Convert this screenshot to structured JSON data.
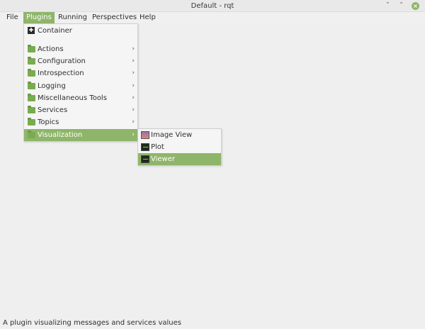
{
  "window": {
    "title": "Default - rqt",
    "minimize_glyph": "˅",
    "maximize_glyph": "˄",
    "close_glyph": "×"
  },
  "menubar": {
    "file": "File",
    "plugins": "Plugins",
    "running": "Running",
    "perspectives": "Perspectives",
    "help": "Help"
  },
  "plugins_menu": {
    "items": [
      {
        "label": "Container",
        "icon": "container-icon"
      },
      {
        "label": "Actions",
        "icon": "folder-icon"
      },
      {
        "label": "Configuration",
        "icon": "folder-icon"
      },
      {
        "label": "Introspection",
        "icon": "folder-icon"
      },
      {
        "label": "Logging",
        "icon": "folder-icon"
      },
      {
        "label": "Miscellaneous Tools",
        "icon": "folder-icon"
      },
      {
        "label": "Services",
        "icon": "folder-icon"
      },
      {
        "label": "Topics",
        "icon": "folder-icon"
      },
      {
        "label": "Visualization",
        "icon": "folder-icon"
      }
    ],
    "submenu_arrow": "›"
  },
  "visualization_menu": {
    "items": [
      {
        "label": "Image View",
        "icon": "image-icon"
      },
      {
        "label": "Plot",
        "icon": "scope-icon"
      },
      {
        "label": "Viewer",
        "icon": "scope-icon"
      }
    ]
  },
  "statusbar": {
    "text": "A plugin visualizing messages and services values"
  },
  "colors": {
    "highlight": "#8fb56a",
    "folder": "#79ab4f",
    "background": "#efefef"
  }
}
